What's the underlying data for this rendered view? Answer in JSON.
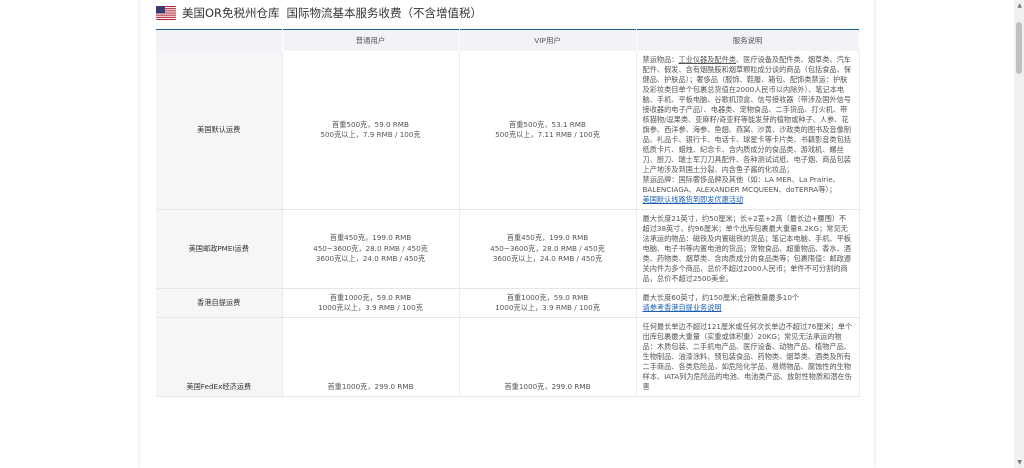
{
  "header": {
    "title": "美国OR免税州仓库",
    "subtitle": "国际物流基本服务收费（不含增值税）"
  },
  "table": {
    "columns": [
      "",
      "普通用户",
      "VIP用户",
      "服务说明"
    ],
    "rows": [
      {
        "name": "美国默认运费",
        "normal": [
          "首重500克，59.0 RMB",
          "500克以上，7.9 RMB / 100克"
        ],
        "vip": [
          "首重500克，53.1 RMB",
          "500克以上，7.11 RMB / 100克"
        ],
        "desc": {
          "prefix": "禁运物品：",
          "highlight": "工业仪器及配件类",
          "body": "、医疗设备及配件类、烟草类、汽车配件、假发、含有烟酰胺和烟草颗粒成分谈的商品（包括食品、保健品、护肤品）；奢侈品（服饰、鞋履、箱包、配饰类禁运：护肤及彩妆类目单个包裹总货值在2000人民币以内除外）、笔记本电脑、手机、平板电脑、谷歌机顶盒、信号接收器（带涉及国外信号接收器的电子产品）、电器类、宠物食品、二手货品、打火机、带核猫物/逗果类、亚麻籽/奇亚籽等能发芽的植物或种子、人参、花旗参、西洋参、海参、鱼翅、燕窝、沙黄、沙政类的图书及音像制品、礼品卡、银行卡、电话卡、球星卡等卡片类、书籍影音类包括纸质卡片、蜡烛、纪念卡、含内质成分的食品类、游戏机、螺丝刀、厨刀、瑞士军刀刀具配件、各种测试试纸、电子烟、商品包装上产地涉及到国土分裂、内含鱼子酱的化妆品；",
          "brands": "禁运品牌：国际奢侈品牌及其他（如：LA MER、La Prairie、BALENCIAGA、ALEXANDER MCQUEEN、doTERRA等）；",
          "link": "美国默认线路货到即发优惠活动"
        }
      },
      {
        "name": "美国邮政PMEI运费",
        "normal": [
          "首重450克，199.0 RMB",
          "450~3600克，28.0 RMB / 450克",
          "3600克以上，24.0 RMB / 450克"
        ],
        "vip": [
          "首重450克，199.0 RMB",
          "450~3600克，28.0 RMB / 450克",
          "3600克以上，24.0 RMB / 450克"
        ],
        "desc": {
          "text": "最大长度21英寸，约50厘米；长+2宽+2高（最长边+腰围）不超过38英寸，约96厘米；单个出库包裹最大重量8.2KG；常见无法承运的物品：磁铁及内置磁铁的货品；笔记本电脑、手机、平板电脑、电子书等内置电池的货品；宠物食品、超重物品、香水、酒类、药物类、烟草类、含肉质成分的食品类等；包裹限值：邮政遵关内件为多个商品，总价不超过2000人民币；单件不可分割的商品，总价不超过2500美金。"
        }
      },
      {
        "name": "香港自提运费",
        "normal": [
          "首重1000克，59.0 RMB",
          "1000克以上，3.9 RMB / 100克"
        ],
        "vip": [
          "首重1000克，59.0 RMB",
          "1000克以上，3.9 RMB / 100克"
        ],
        "desc": {
          "text": "最大长度60英寸，约150厘米;合箱数量最多10个",
          "link": "请参考香港自提业务说明"
        }
      },
      {
        "name": "美国FedEx经济运费",
        "normal": [
          "首重1000克，299.0 RMB"
        ],
        "vip": [
          "首重1000克，299.0 RMB"
        ],
        "desc": {
          "text": "任何最长单边不超过121厘米或任何次长单边不超过76厘米；单个出库包裹最大重量（实重或体积重）20KG；常见无法承运的物品：木质包装、二手机电产品、医疗设备、动物产品、植物产品、生物制品、油漆涂料、预包装食品、药物类、烟草类、酒类及所有二手商品、各类危险品，如危险化学品、易燃物品、腐蚀性的生物样本、IATA列为危险品的电池、电池类产品、放射性物质和潜在伤害"
        }
      }
    ]
  }
}
